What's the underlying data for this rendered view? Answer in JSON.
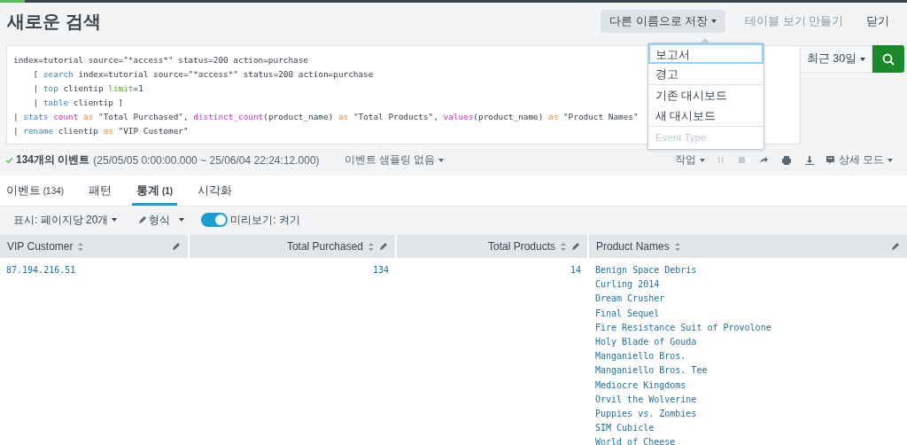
{
  "header": {
    "title": "새로운 검색",
    "actions": [
      {
        "label": "다른 이름으로 저장",
        "kind": "dropdown"
      },
      {
        "label": "테이블 보기 만들기",
        "kind": "link",
        "disabled": true
      },
      {
        "label": "닫기",
        "kind": "link",
        "disabled": false
      }
    ]
  },
  "search": {
    "query_lines": [
      [
        {
          "text": "index=tutorial source=\"*access*\" status=200 action=purchase",
          "kind": "plain"
        }
      ],
      [
        {
          "text": "    [ ",
          "kind": "plain"
        },
        {
          "text": "search",
          "kind": "command"
        },
        {
          "text": " index=tutorial source=\"*access*\" status=200 action=purchase",
          "kind": "plain"
        }
      ],
      [
        {
          "text": "    | ",
          "kind": "plain"
        },
        {
          "text": "top",
          "kind": "command"
        },
        {
          "text": " clientip ",
          "kind": "plain"
        },
        {
          "text": "limit",
          "kind": "argument"
        },
        {
          "text": "=1",
          "kind": "plain"
        }
      ],
      [
        {
          "text": "    | ",
          "kind": "plain"
        },
        {
          "text": "table",
          "kind": "command"
        },
        {
          "text": " clientip ]",
          "kind": "plain"
        }
      ],
      [
        {
          "text": "| ",
          "kind": "plain"
        },
        {
          "text": "stats",
          "kind": "command"
        },
        {
          "text": " count",
          "kind": "function"
        },
        {
          "text": " as",
          "kind": "keyword"
        },
        {
          "text": " \"Total Purchased\", ",
          "kind": "plain"
        },
        {
          "text": "distinct_count",
          "kind": "function"
        },
        {
          "text": "(product_name) ",
          "kind": "plain"
        },
        {
          "text": "as",
          "kind": "keyword"
        },
        {
          "text": " \"Total Products\", ",
          "kind": "plain"
        },
        {
          "text": "values",
          "kind": "function"
        },
        {
          "text": "(product_name) ",
          "kind": "plain"
        },
        {
          "text": "as",
          "kind": "keyword"
        },
        {
          "text": " \"Product Names\"",
          "kind": "plain"
        }
      ],
      [
        {
          "text": "| ",
          "kind": "plain"
        },
        {
          "text": "rename",
          "kind": "command"
        },
        {
          "text": " clientip ",
          "kind": "plain"
        },
        {
          "text": "as",
          "kind": "keyword"
        },
        {
          "text": " \"VIP Customer\"",
          "kind": "plain"
        }
      ]
    ],
    "time_range": "최근 30일"
  },
  "save_menu": {
    "items": [
      {
        "label": "보고서",
        "focused": true,
        "disabled": false,
        "divider_before": false
      },
      {
        "label": "경고",
        "focused": false,
        "disabled": false,
        "divider_before": false
      },
      {
        "label": "기존 대시보드",
        "focused": false,
        "disabled": false,
        "divider_before": true
      },
      {
        "label": "새 대시보드",
        "focused": false,
        "disabled": false,
        "divider_before": false
      },
      {
        "label": "Event Type",
        "focused": false,
        "disabled": true,
        "divider_before": true
      }
    ]
  },
  "job_status": {
    "count": "134개의 이벤트",
    "range": "(25/05/05 0:00:00.000 ~ 25/06/04 22:24:12.000)",
    "sampling": "이벤트 샘플링 없음",
    "job_menu": "작업",
    "mode": "상세 모드"
  },
  "tabs": [
    {
      "label": "이벤트",
      "count": "(134)",
      "selected": false
    },
    {
      "label": "패턴",
      "selected": false
    },
    {
      "label": "통계",
      "count": "(1)",
      "selected": true
    },
    {
      "label": "시각화",
      "selected": false
    }
  ],
  "options": {
    "per_page": "표시: 페이지당 20개",
    "format": "형식",
    "preview": {
      "label": "미리보기: 켜기",
      "on": true
    }
  },
  "table": {
    "columns": [
      {
        "label": "VIP Customer",
        "kind": "text"
      },
      {
        "label": "Total Purchased",
        "kind": "number"
      },
      {
        "label": "Total Products",
        "kind": "number"
      },
      {
        "label": "Product Names",
        "kind": "list"
      }
    ],
    "rows": [
      {
        "cells": [
          {
            "value": "87.194.216.51"
          },
          {
            "value": "134"
          },
          {
            "value": "14"
          },
          {
            "values": [
              "Benign Space Debris",
              "Curling 2014",
              "Dream Crusher",
              "Final Sequel",
              "Fire Resistance Suit of Provolone",
              "Holy Blade of Gouda",
              "Manganiello Bros.",
              "Manganiello Bros. Tee",
              "Mediocre Kingdoms",
              "Orvil the Wolverine",
              "Puppies vs. Zombies",
              "SIM Cubicle",
              "World of Cheese"
            ]
          }
        ]
      }
    ]
  }
}
